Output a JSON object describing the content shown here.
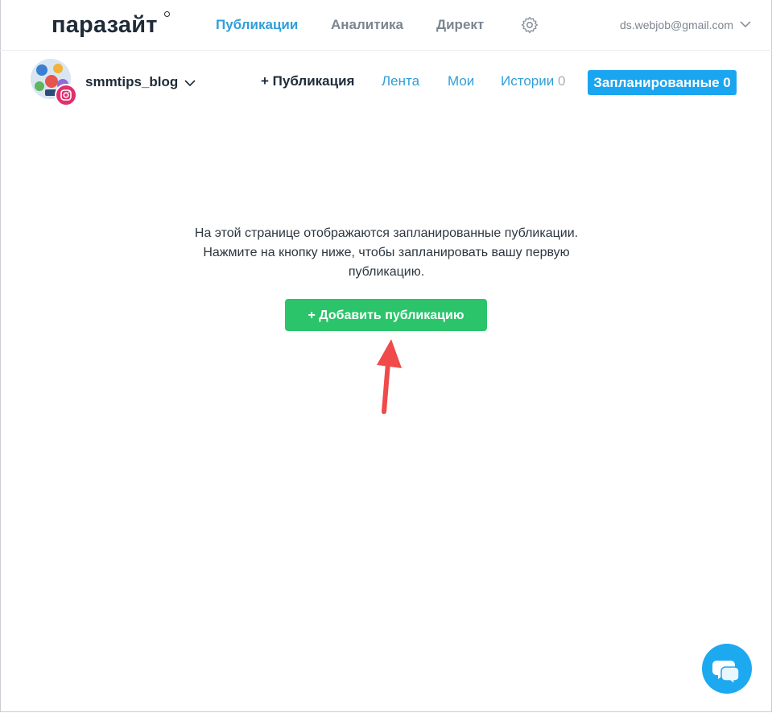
{
  "app": {
    "logo_text": "паразайт"
  },
  "topnav": {
    "items": [
      "Публикации",
      "Аналитика",
      "Директ"
    ],
    "active": "Публикации",
    "settings_icon": "gear-icon",
    "account_email": "ds.webjob@gmail.com"
  },
  "account": {
    "name": "smmtips_blog",
    "network_icon": "instagram-icon"
  },
  "subnav": {
    "publication": "+ Публикация",
    "feed": "Лента",
    "mine": "Мои",
    "stories_label": "Истории",
    "stories_count": "0",
    "scheduled": "Запланированные 0"
  },
  "main": {
    "empty_line1": "На этой странице отображаются запланированные публикации.",
    "empty_line2": "Нажмите на кнопку ниже, чтобы запланировать вашу первую",
    "empty_line3": "публикацию.",
    "add_button": "+ Добавить публикацию"
  },
  "colors": {
    "accent_blue": "#2f9fd8",
    "scheduled_button": "#1aa5f0",
    "add_button": "#2bc46a",
    "arrow": "#f04a4a",
    "chat_button": "#1da9f0"
  }
}
